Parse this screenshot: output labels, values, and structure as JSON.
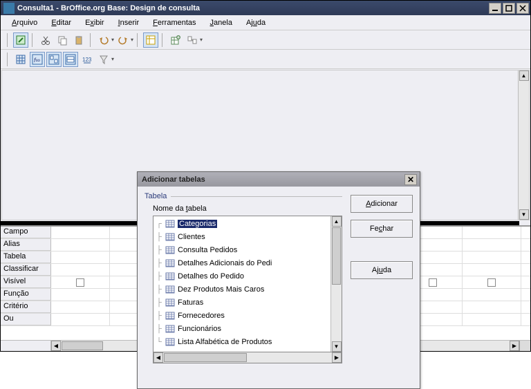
{
  "window": {
    "title": "Consulta1 - BrOffice.org Base: Design de consulta"
  },
  "menu": {
    "arquivo": "Arquivo",
    "editar": "Editar",
    "exibir": "Exibir",
    "inserir": "Inserir",
    "ferramentas": "Ferramentas",
    "janela": "Janela",
    "ajuda": "Ajuda"
  },
  "grid": {
    "rows": {
      "campo": "Campo",
      "alias": "Alias",
      "tabela": "Tabela",
      "classificar": "Classificar",
      "visivel": "Visível",
      "funcao": "Função",
      "criterio": "Critério",
      "ou": "Ou"
    }
  },
  "dialog": {
    "title": "Adicionar tabelas",
    "fieldset": "Tabela",
    "list_label": "Nome da tabela",
    "items": [
      "Categorias",
      "Clientes",
      "Consulta Pedidos",
      "Detalhes Adicionais do Pedi",
      "Detalhes do Pedido",
      "Dez Produtos Mais Caros",
      "Faturas",
      "Fornecedores",
      "Funcionários",
      "Lista Alfabética de Produtos"
    ],
    "buttons": {
      "add": "Adicionar",
      "close": "Fechar",
      "help": "Ajuda"
    }
  }
}
